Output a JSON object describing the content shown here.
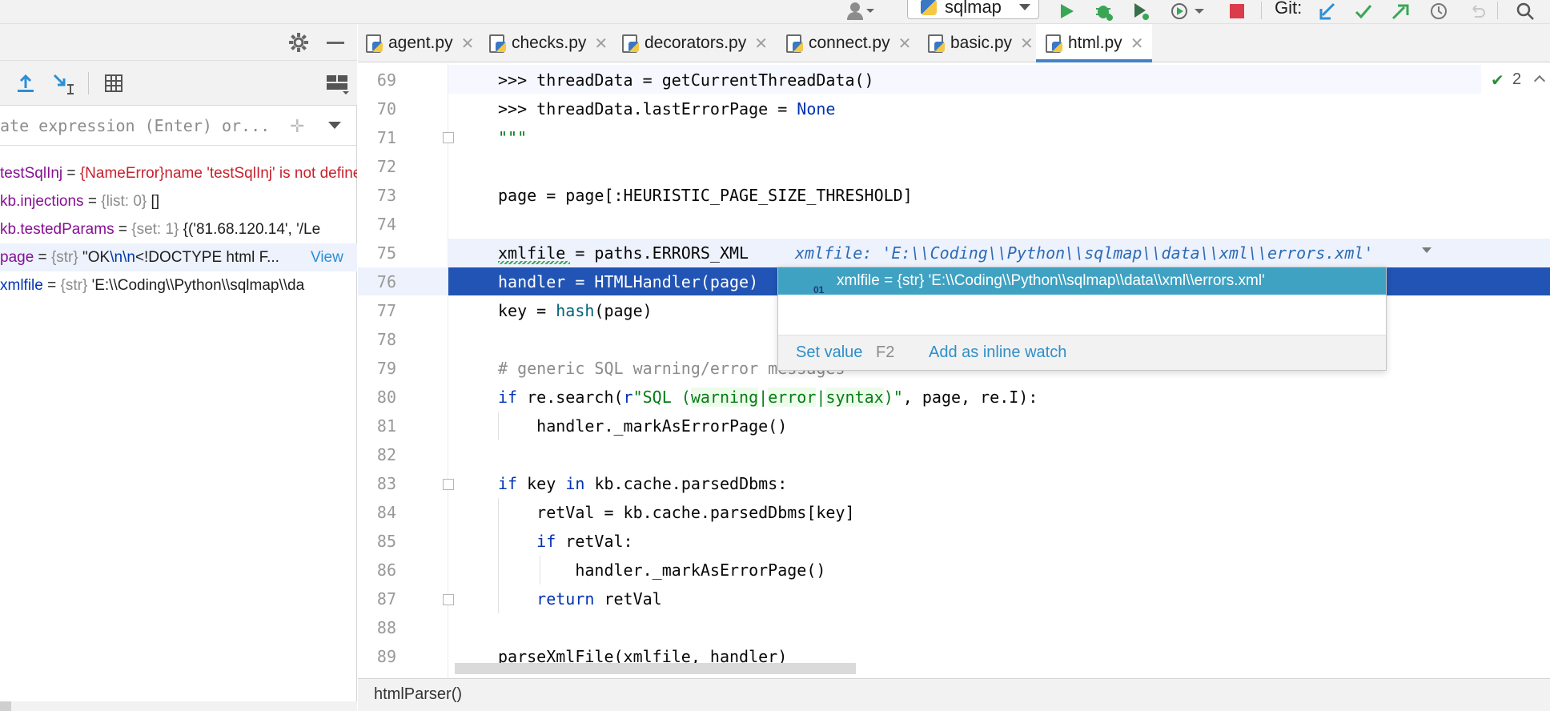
{
  "toolbar": {
    "run_config": "sqlmap",
    "git_label": "Git:"
  },
  "debug_panel": {
    "eval_placeholder": "ate expression (Enter) or...",
    "variables": [
      {
        "name": "testSqlInj",
        "eq": " = ",
        "type": "{NameError}",
        "value": "name 'testSqlInj' is not defined"
      },
      {
        "name": "kb.injections",
        "eq": " = ",
        "type": "{list: 0}",
        "value": " []"
      },
      {
        "name": "kb.testedParams",
        "eq": " = ",
        "type": "{set: 1}",
        "value": " {('81.68.120.14', '/Le"
      },
      {
        "name": "page",
        "eq": " = ",
        "type": "{str}",
        "value_a": " \"OK",
        "value_esc": "\\n\\n",
        "value_b": "<!DOCTYPE html F...",
        "link": " View"
      },
      {
        "name": "xmlfile",
        "eq": " = ",
        "type": "{str}",
        "value": " 'E:\\\\Coding\\\\Python\\\\sqlmap\\\\da"
      }
    ]
  },
  "tabs": [
    {
      "label": "agent.py"
    },
    {
      "label": "checks.py"
    },
    {
      "label": "decorators.py"
    },
    {
      "label": "connect.py"
    },
    {
      "label": "basic.py"
    },
    {
      "label": "html.py"
    }
  ],
  "editor": {
    "inspection_count": "2",
    "inline_hint": "xmlfile: 'E:\\\\Coding\\\\Python\\\\sqlmap\\\\data\\\\xml\\\\errors.xml'",
    "lines": [
      {
        "n": "69",
        "t": ">>> threadData = getCurrentThreadData()"
      },
      {
        "n": "70",
        "t": ">>> threadData.lastErrorPage = None"
      },
      {
        "n": "71",
        "t": "\"\"\""
      },
      {
        "n": "72",
        "t": ""
      },
      {
        "n": "73",
        "t": "page = page[:HEURISTIC_PAGE_SIZE_THRESHOLD]"
      },
      {
        "n": "74",
        "t": ""
      },
      {
        "n": "75",
        "t": "xmlfile = paths.ERRORS_XML"
      },
      {
        "n": "76",
        "t": "handler = HTMLHandler(page)"
      },
      {
        "n": "77",
        "t": "key = hash(page)"
      },
      {
        "n": "78",
        "t": ""
      },
      {
        "n": "79",
        "t": "# generic SQL warning/error messages"
      },
      {
        "n": "80",
        "t": "if re.search(r\"SQL (warning|error|syntax)\", page, re.I):"
      },
      {
        "n": "81",
        "t": "    handler._markAsErrorPage()"
      },
      {
        "n": "82",
        "t": ""
      },
      {
        "n": "83",
        "t": "if key in kb.cache.parsedDbms:"
      },
      {
        "n": "84",
        "t": "    retVal = kb.cache.parsedDbms[key]"
      },
      {
        "n": "85",
        "t": "    if retVal:"
      },
      {
        "n": "86",
        "t": "        handler._markAsErrorPage()"
      },
      {
        "n": "87",
        "t": "    return retVal"
      },
      {
        "n": "88",
        "t": ""
      },
      {
        "n": "89",
        "t": "parseXmlFile(xmlfile, handler)"
      }
    ]
  },
  "popup": {
    "value_row": "xmlfile = {str} 'E:\\\\Coding\\\\Python\\\\sqlmap\\\\data\\\\xml\\\\errors.xml'",
    "value_icon": "01",
    "set_value": "Set value",
    "set_value_key": "F2",
    "add_watch": "Add as inline watch"
  },
  "status": {
    "breadcrumb": "htmlParser()"
  },
  "colors": {
    "accent": "#4083c9",
    "selection": "#2154b4",
    "popup_row": "#3fa2c2"
  }
}
